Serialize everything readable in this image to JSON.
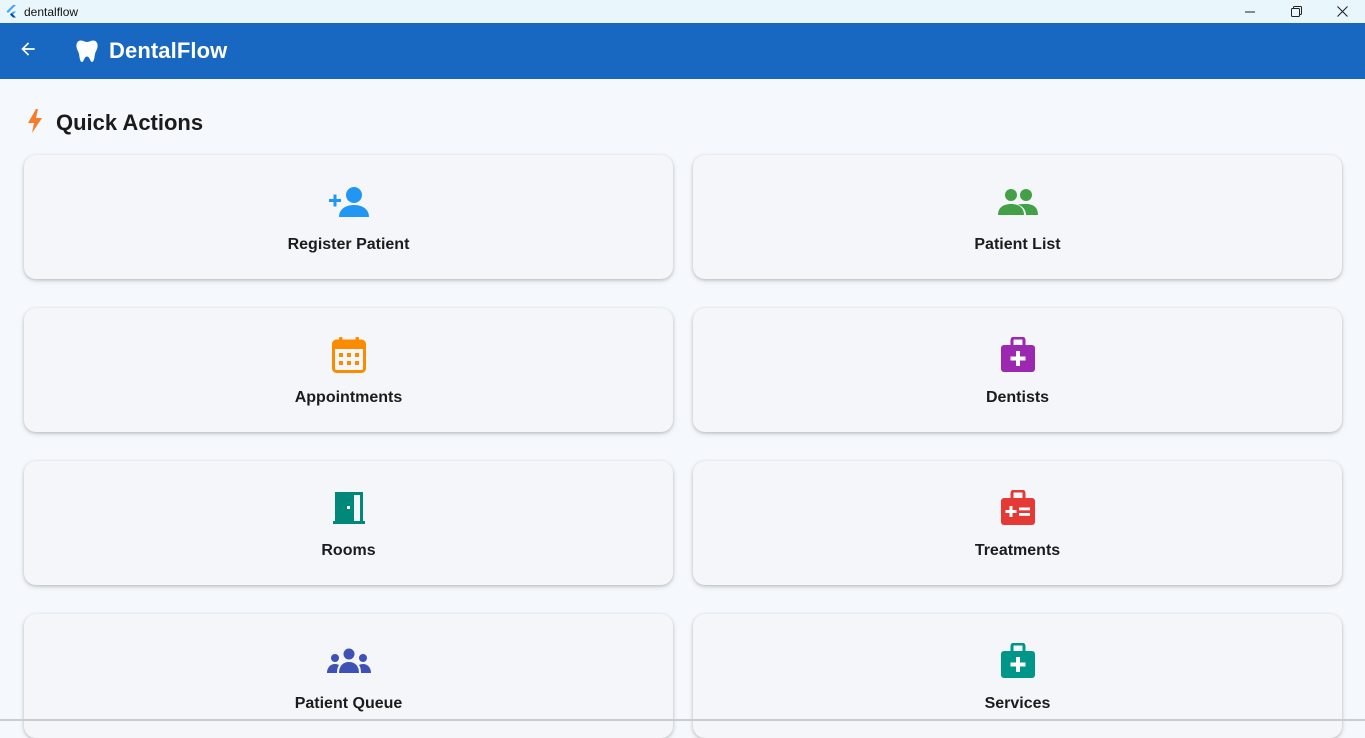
{
  "window": {
    "title": "dentalflow",
    "logo_icon": "flutter-logo-icon",
    "controls": [
      "minimize-icon",
      "restore-icon",
      "close-icon"
    ]
  },
  "appbar": {
    "title": "DentalFlow",
    "back_icon": "arrow-back-icon",
    "brand_icon": "tooth-icon",
    "color": "#1867c0"
  },
  "section": {
    "title": "Quick Actions",
    "icon": "bolt-icon",
    "icon_color": "#f57c2b"
  },
  "actions": [
    {
      "label": "Register Patient",
      "icon": "person-add-icon",
      "color": "#2196f3"
    },
    {
      "label": "Patient List",
      "icon": "people-icon",
      "color": "#43a047"
    },
    {
      "label": "Appointments",
      "icon": "calendar-icon",
      "color": "#fb8c00"
    },
    {
      "label": "Dentists",
      "icon": "medical-bag-icon",
      "color": "#9c27b0"
    },
    {
      "label": "Rooms",
      "icon": "door-icon",
      "color": "#00897b"
    },
    {
      "label": "Treatments",
      "icon": "medical-kit-icon",
      "color": "#e53935"
    },
    {
      "label": "Patient Queue",
      "icon": "groups-icon",
      "color": "#3f51b5"
    },
    {
      "label": "Services",
      "icon": "medical-case-icon",
      "color": "#009688"
    }
  ]
}
